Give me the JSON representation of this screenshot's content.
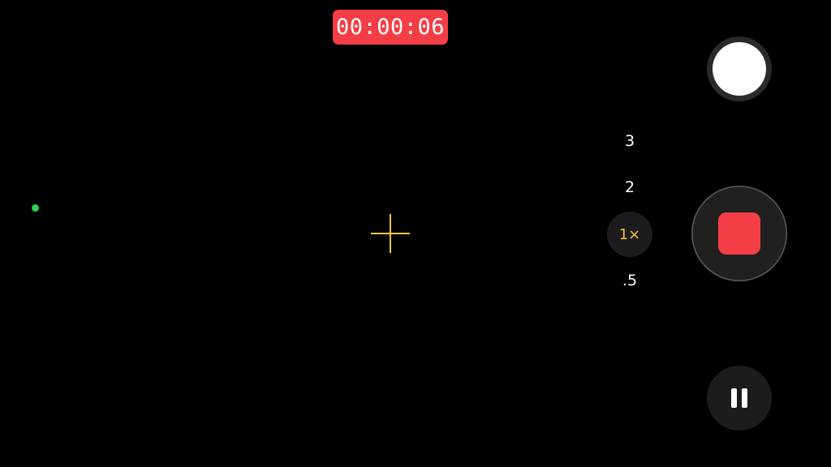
{
  "recording": {
    "elapsed_time": "00:00:06"
  },
  "zoom": {
    "options": [
      {
        "label": "3"
      },
      {
        "label": "2"
      },
      {
        "label": "1×"
      },
      {
        "label": ".5"
      }
    ],
    "selected": "1×"
  },
  "icons": {
    "focus": "focus-crosshair-icon",
    "indicator": "camera-active-indicator-icon",
    "snapshot": "snapshot-shutter-icon",
    "record": "stop-recording-icon",
    "pause": "pause-icon"
  },
  "colors": {
    "background": "#000000",
    "timer_background": "#f43e45",
    "record_red": "#f43e45",
    "focus_yellow": "#f6c431",
    "indicator_green": "#30d158",
    "control_dark": "#1c1c1e"
  }
}
